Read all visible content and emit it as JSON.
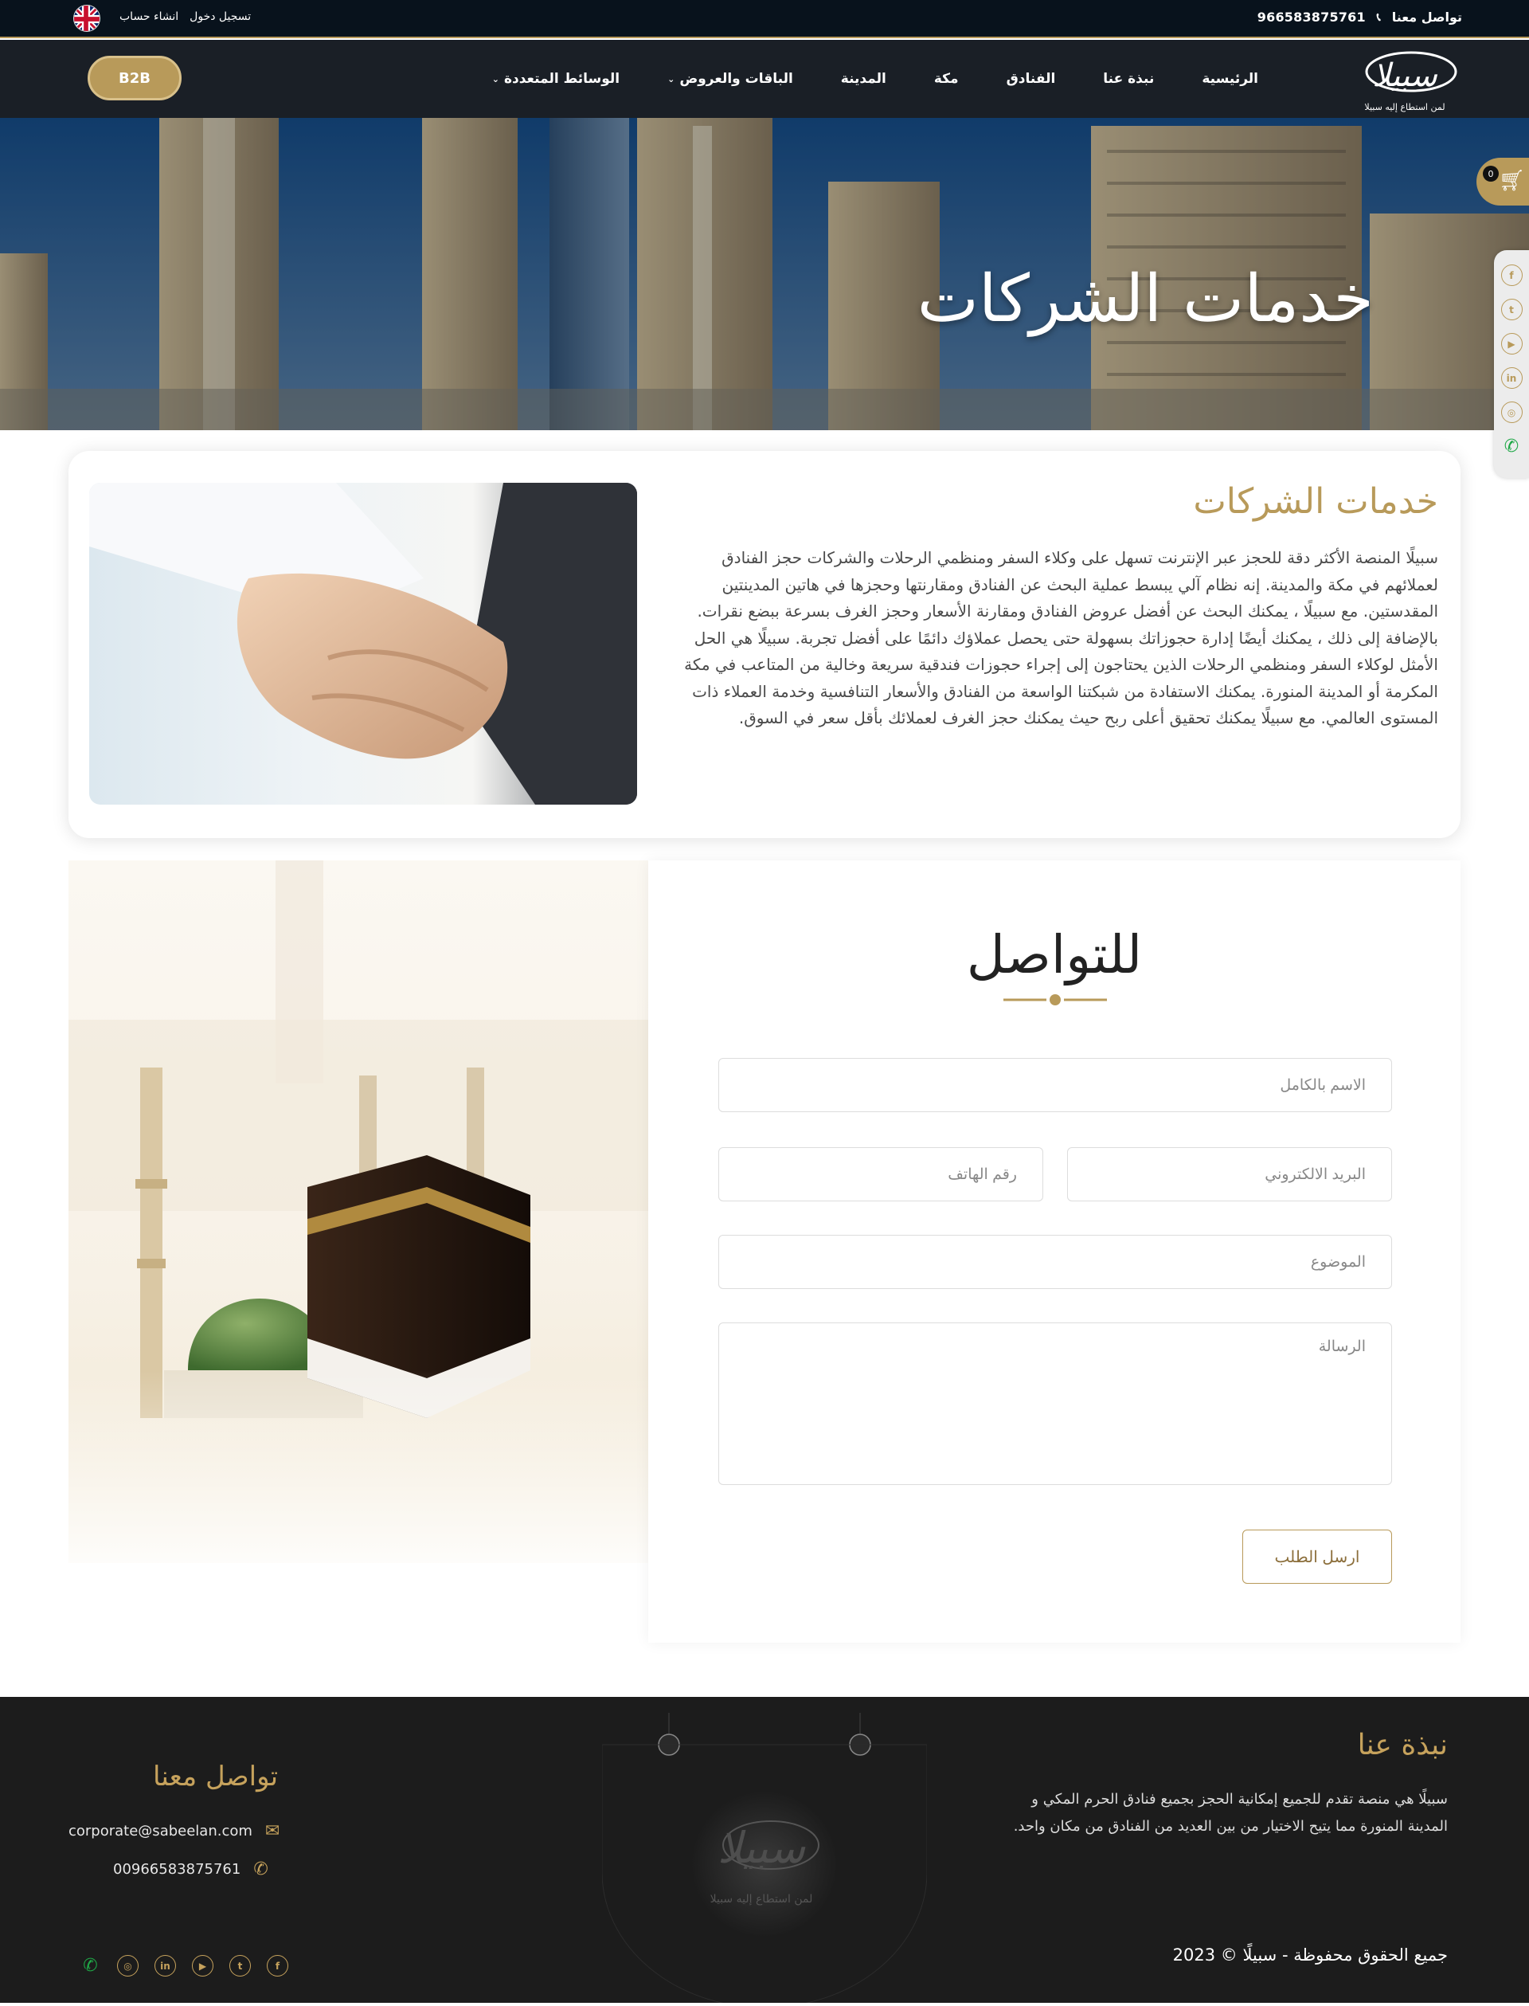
{
  "topbar": {
    "contact_label": "تواصل معنا",
    "phone": "966583875761",
    "login": "تسجيل دخول",
    "register": "انشاء حساب",
    "language_icon": "uk-flag-icon"
  },
  "nav": {
    "logo_text": "سبيلا",
    "logo_tagline": "لمن استطاع إليه سبيلا",
    "items": [
      {
        "label": "الرئيسية"
      },
      {
        "label": "نبذة عنا"
      },
      {
        "label": "الفنادق"
      },
      {
        "label": "مكة"
      },
      {
        "label": "المدينة"
      },
      {
        "label": "الباقات والعروض",
        "dropdown": true
      },
      {
        "label": "الوسائط المتعددة",
        "dropdown": true
      }
    ],
    "b2b": "B2B"
  },
  "hero": {
    "title": "خدمات الشركات"
  },
  "cart": {
    "count": "0"
  },
  "side_social": [
    "facebook-icon",
    "twitter-icon",
    "youtube-icon",
    "linkedin-icon",
    "instagram-icon",
    "whatsapp-icon"
  ],
  "services": {
    "title": "خدمات الشركات",
    "body": "سبيلًا المنصة الأكثر دقة للحجز عبر الإنترنت تسهل على وكلاء السفر ومنظمي الرحلات والشركات حجز الفنادق لعملائهم في مكة والمدينة. إنه نظام آلي يبسط عملية البحث عن الفنادق ومقارنتها وحجزها في هاتين المدينتين المقدستين. مع سبيلًا ، يمكنك البحث عن أفضل عروض الفنادق ومقارنة الأسعار وحجز الغرف بسرعة ببضع نقرات. بالإضافة إلى ذلك ، يمكنك أيضًا إدارة حجوزاتك بسهولة حتى يحصل عملاؤك دائمًا على أفضل تجربة. سبيلًا هي الحل الأمثل لوكلاء السفر ومنظمي الرحلات الذين يحتاجون إلى إجراء حجوزات فندقية سريعة وخالية من المتاعب في مكة المكرمة أو المدينة المنورة. يمكنك الاستفادة من شبكتنا الواسعة من الفنادق والأسعار التنافسية وخدمة العملاء ذات المستوى العالمي. مع سبيلًا يمكنك تحقيق أعلى ربح حيث يمكنك حجز الغرف لعملائك بأقل سعر في السوق."
  },
  "contact_form": {
    "title": "للتواصل",
    "full_name_placeholder": "الاسم بالكامل",
    "email_placeholder": "البريد الالكتروني",
    "phone_placeholder": "رقم الهاتف",
    "subject_placeholder": "الموضوع",
    "message_placeholder": "الرسالة",
    "submit": "ارسل الطلب"
  },
  "footer": {
    "about_title": "نبذة عنا",
    "about_text": "سبيلًا هي منصة تقدم للجميع إمكانية الحجز بجميع فنادق الحرم المكي و المدينة المنورة مما يتيح الاختيار من بين العديد من الفنادق من مكان واحد.",
    "contact_title": "تواصل معنا",
    "email": "corporate@sabeelan.com",
    "phone": "00966583875761",
    "copyright": "جميع الحقوق محفوظة - سبيلًا © 2023",
    "logo_text": "سبيلا",
    "logo_tagline": "لمن استطاع إليه سبيلا"
  },
  "colors": {
    "accent": "#b89a5a",
    "dark": "#08121c",
    "footer": "#1c1c1c"
  }
}
